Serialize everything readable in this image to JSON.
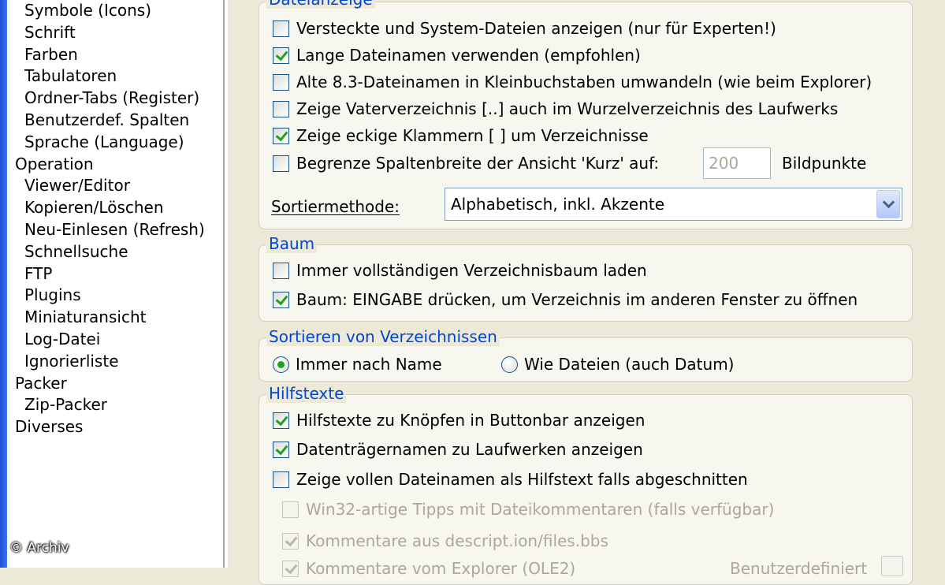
{
  "tree": {
    "items": [
      {
        "label": "Symbole (Icons)",
        "level": 1
      },
      {
        "label": "Schrift",
        "level": 1
      },
      {
        "label": "Farben",
        "level": 1
      },
      {
        "label": "Tabulatoren",
        "level": 1
      },
      {
        "label": "Ordner-Tabs (Register)",
        "level": 1
      },
      {
        "label": "Benutzerdef. Spalten",
        "level": 1
      },
      {
        "label": "Sprache (Language)",
        "level": 1
      },
      {
        "label": "Operation",
        "level": 0
      },
      {
        "label": "Viewer/Editor",
        "level": 1
      },
      {
        "label": "Kopieren/Löschen",
        "level": 1
      },
      {
        "label": "Neu-Einlesen (Refresh)",
        "level": 1
      },
      {
        "label": "Schnellsuche",
        "level": 1
      },
      {
        "label": "FTP",
        "level": 1
      },
      {
        "label": "Plugins",
        "level": 1
      },
      {
        "label": "Miniaturansicht",
        "level": 1
      },
      {
        "label": "Log-Datei",
        "level": 1
      },
      {
        "label": "Ignorierliste",
        "level": 1
      },
      {
        "label": "Packer",
        "level": 0
      },
      {
        "label": "Zip-Packer",
        "level": 1
      },
      {
        "label": "Diverses",
        "level": 0
      }
    ]
  },
  "watermark": "© Archiv",
  "dateianzeige": {
    "legend": "Dateianzeige",
    "show_hidden": {
      "label": "Versteckte und System-Dateien anzeigen (nur für Experten!)",
      "checked": false
    },
    "long_names": {
      "label": "Lange Dateinamen verwenden (empfohlen)",
      "checked": true
    },
    "lowercase_83": {
      "label": "Alte 8.3-Dateinamen in Kleinbuchstaben umwandeln (wie beim Explorer)",
      "checked": false
    },
    "parent_dir": {
      "label": "Zeige Vaterverzeichnis [..] auch im Wurzelverzeichnis des Laufwerks",
      "checked": false
    },
    "brackets": {
      "label": "Zeige eckige Klammern [ ] um Verzeichnisse",
      "checked": true
    },
    "limit_width": {
      "label": "Begrenze Spaltenbreite der Ansicht 'Kurz' auf:",
      "checked": false
    },
    "limit_value": "200",
    "limit_unit": "Bildpunkte",
    "sort_label": "Sortiermethode:",
    "sort_value": "Alphabetisch, inkl. Akzente"
  },
  "baum": {
    "legend": "Baum",
    "full_tree": {
      "label": "Immer vollständigen Verzeichnisbaum laden",
      "checked": false
    },
    "enter_open": {
      "label": "Baum: EINGABE drücken, um Verzeichnis im anderen Fenster zu öffnen",
      "checked": true
    }
  },
  "sortieren": {
    "legend": "Sortieren von Verzeichnissen",
    "by_name": {
      "label": "Immer nach Name",
      "selected": true
    },
    "like_files": {
      "label": "Wie Dateien (auch Datum)",
      "selected": false
    }
  },
  "hilfstexte": {
    "legend": "Hilfstexte",
    "buttonbar": {
      "label": "Hilfstexte zu Knöpfen in Buttonbar anzeigen",
      "checked": true
    },
    "volume_names": {
      "label": "Datenträgernamen zu Laufwerken anzeigen",
      "checked": true
    },
    "full_name": {
      "label": "Zeige vollen Dateinamen als Hilfstext falls abgeschnitten",
      "checked": false
    },
    "win32_tips": {
      "label": "Win32-artige Tipps mit Dateikommentaren (falls verfügbar)",
      "checked": false
    },
    "descript": {
      "label": "Kommentare aus descript.ion/files.bbs",
      "checked": true
    },
    "explorer": {
      "label": "Kommentare vom Explorer (OLE2)",
      "checked": true
    },
    "user_def": "Benutzerdefiniert"
  }
}
